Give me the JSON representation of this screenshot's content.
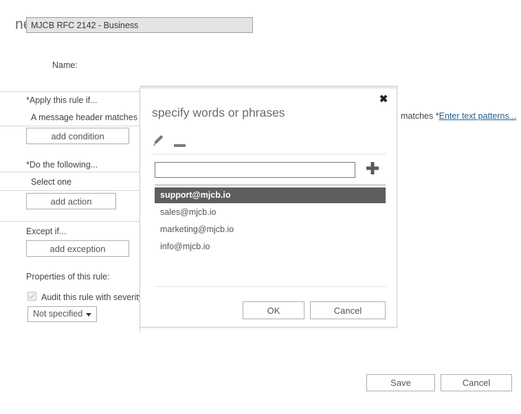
{
  "page": {
    "title": "new rule"
  },
  "form": {
    "name_label": "Name:",
    "name_value": "MJCB RFC 2142 - Business",
    "name_placeholder": "",
    "apply_label": "*Apply this rule if...",
    "apply_value": "A message header matches...",
    "add_condition_label": "add condition",
    "do_following_label": "*Do the following...",
    "do_following_value": "Select one",
    "add_action_label": "add action",
    "except_label": "Except if...",
    "add_exception_label": "add exception",
    "properties_label": "Properties of this rule:",
    "audit_checkbox_label": "Audit this rule with severity",
    "audit_checkbox_checked": true,
    "severity_value": "Not specified",
    "condition_detail_text": "matches",
    "condition_detail_prefix": "*",
    "condition_detail_link": "Enter text patterns..."
  },
  "dialog": {
    "title": "specify words or phrases",
    "close_label": "✖",
    "edit_icon_title": "edit",
    "remove_icon_title": "remove",
    "input_value": "",
    "input_placeholder": "",
    "add_button_label": "+",
    "items": [
      {
        "label": "support@mjcb.io",
        "selected": true
      },
      {
        "label": "sales@mjcb.io",
        "selected": false
      },
      {
        "label": "marketing@mjcb.io",
        "selected": false
      },
      {
        "label": "info@mjcb.io",
        "selected": false
      }
    ],
    "ok_label": "OK",
    "cancel_label": "Cancel"
  },
  "footer": {
    "save_label": "Save",
    "cancel_label": "Cancel"
  },
  "colors": {
    "selection_bg": "#5e5e5e",
    "link": "#23618e",
    "text": "#444444",
    "border": "#adadad",
    "input_bg": "#e4e4e4"
  }
}
